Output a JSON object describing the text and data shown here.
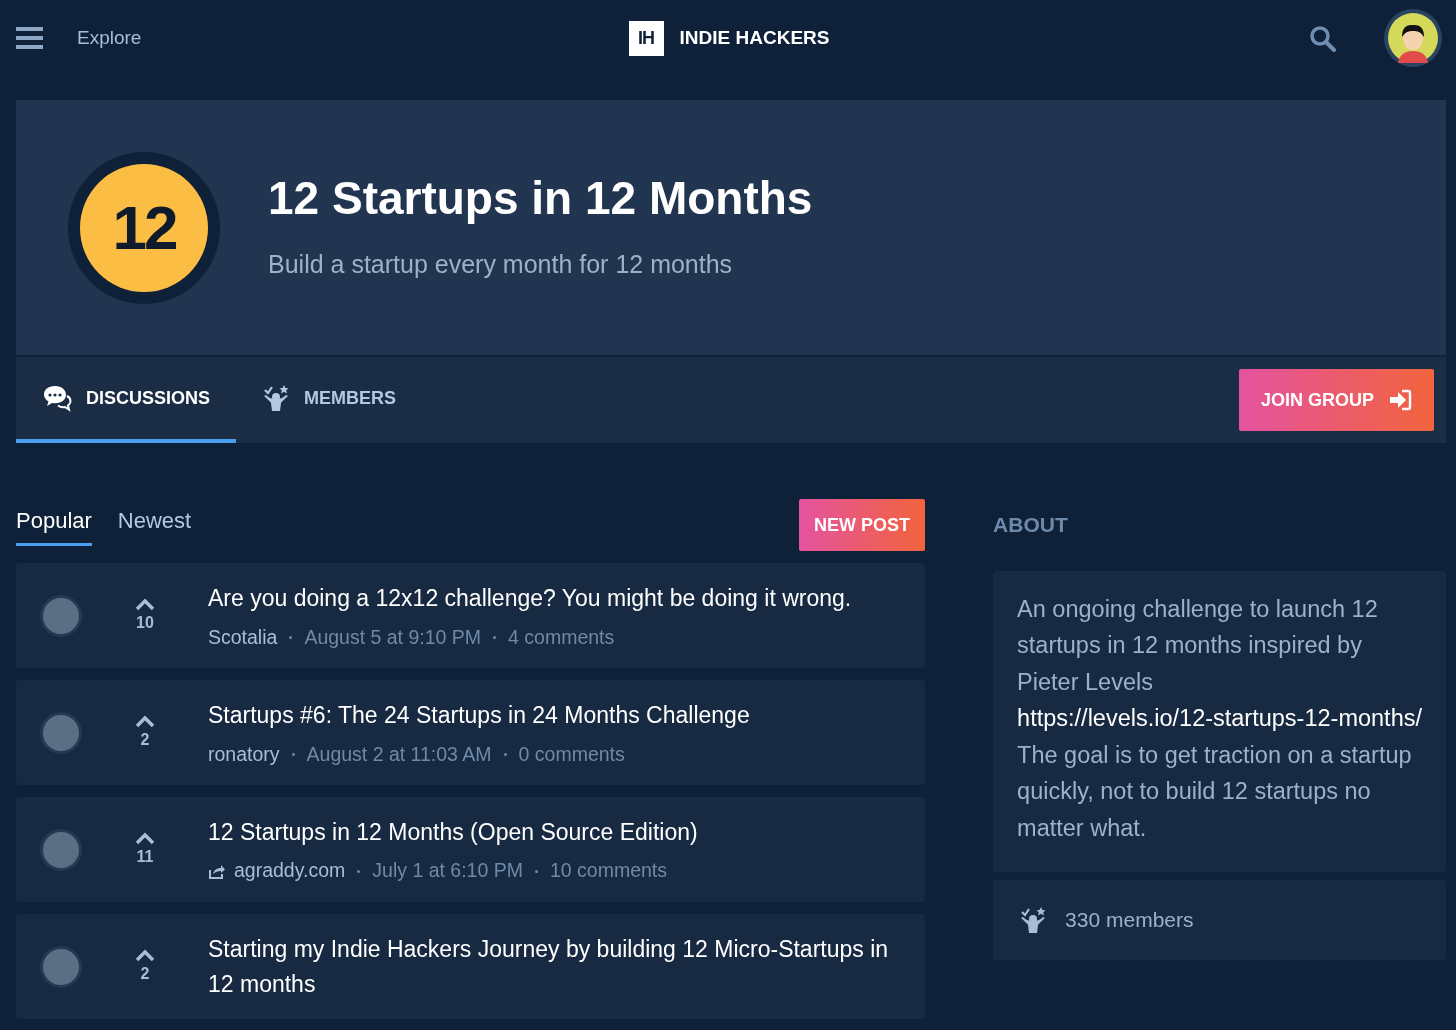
{
  "navbar": {
    "explore": "Explore",
    "logo_mark": "IH",
    "brand": "INDIE HACKERS"
  },
  "group": {
    "badge": "12",
    "title": "12 Startups in 12 Months",
    "subtitle": "Build a startup every month for 12 months"
  },
  "tabs": [
    {
      "label": "DISCUSSIONS",
      "kind": "discussions",
      "selected": true
    },
    {
      "label": "MEMBERS",
      "kind": "members",
      "selected": false
    }
  ],
  "join_button": "JOIN GROUP",
  "sort_tabs": [
    {
      "label": "Popular",
      "selected": true
    },
    {
      "label": "Newest",
      "selected": false
    }
  ],
  "new_post_button": "NEW POST",
  "posts": [
    {
      "votes": "10",
      "title": "Are you doing a 12x12 challenge? You might be doing it wrong.",
      "source": "Scotalia",
      "kind": "user",
      "date": "August 5 at 9:10 PM",
      "comments": "4 comments"
    },
    {
      "votes": "2",
      "title": "Startups #6: The 24 Startups in 24 Months Challenge",
      "source": "ronatory",
      "kind": "user",
      "date": "August 2 at 11:03 AM",
      "comments": "0 comments"
    },
    {
      "votes": "11",
      "title": "12 Startups in 12 Months (Open Source Edition)",
      "source": "agraddy.com",
      "kind": "link",
      "date": "July 1 at 6:10 PM",
      "comments": "10 comments"
    },
    {
      "votes": "2",
      "title": "Starting my Indie Hackers Journey by building 12 Micro-Startups in 12 months"
    }
  ],
  "about": {
    "heading": "ABOUT",
    "text_before": "An ongoing challenge to launch 12 startups in 12 months inspired by Pieter Levels",
    "link": "https://levels.io/12-startups-12-months/",
    "text_after": "The goal is to get traction on a startup quickly, not to build 12 startups no matter what.",
    "members": "330 members"
  }
}
